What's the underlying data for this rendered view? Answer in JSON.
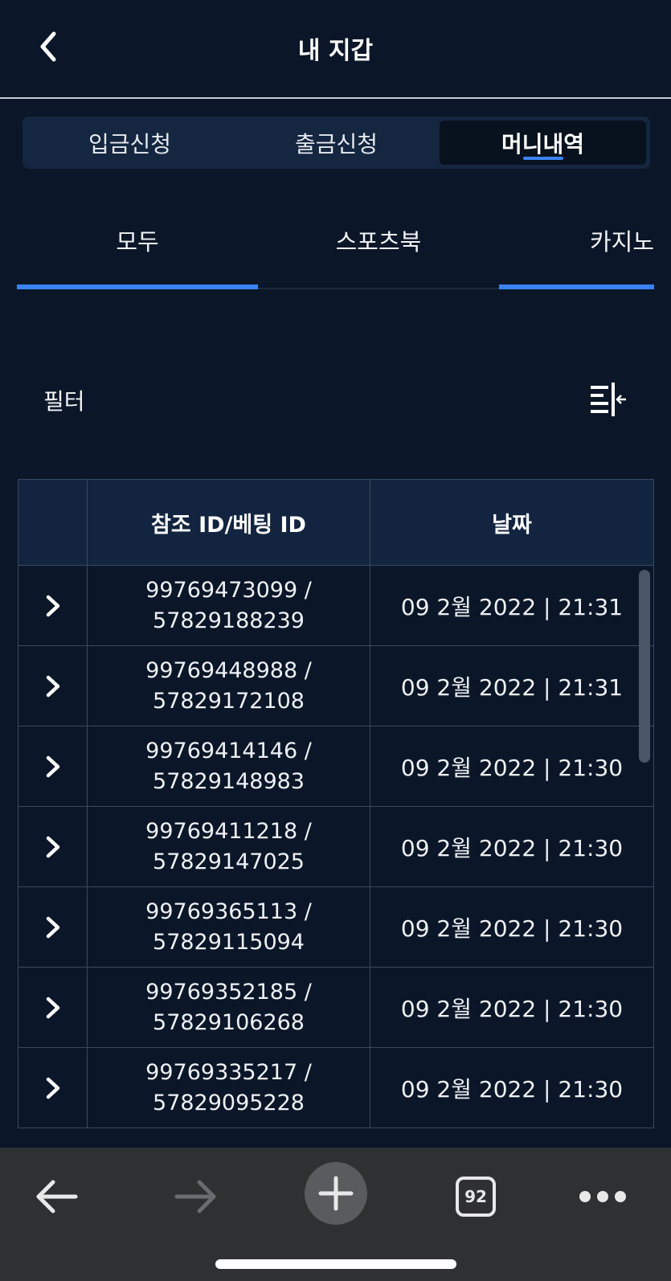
{
  "header": {
    "title": "내 지갑"
  },
  "segments": [
    {
      "label": "입금신청",
      "active": false
    },
    {
      "label": "출금신청",
      "active": false
    },
    {
      "label": "머니내역",
      "active": true
    }
  ],
  "subtabs": [
    {
      "label": "모두"
    },
    {
      "label": "스포츠북"
    },
    {
      "label": "카지노"
    }
  ],
  "filter": {
    "label": "필터"
  },
  "table": {
    "headers": [
      "",
      "참조 ID/베팅 ID",
      "날짜"
    ],
    "rows": [
      {
        "ref": "99769473099 /",
        "bet": "57829188239",
        "date": "09 2월 2022 | 21:31"
      },
      {
        "ref": "99769448988 /",
        "bet": "57829172108",
        "date": "09 2월 2022 | 21:31"
      },
      {
        "ref": "99769414146 /",
        "bet": "57829148983",
        "date": "09 2월 2022 | 21:30"
      },
      {
        "ref": "99769411218 /",
        "bet": "57829147025",
        "date": "09 2월 2022 | 21:30"
      },
      {
        "ref": "99769365113 /",
        "bet": "57829115094",
        "date": "09 2월 2022 | 21:30"
      },
      {
        "ref": "99769352185 /",
        "bet": "57829106268",
        "date": "09 2월 2022 | 21:30"
      },
      {
        "ref": "99769335217 /",
        "bet": "57829095228",
        "date": "09 2월 2022 | 21:30"
      }
    ]
  },
  "browser": {
    "tab_count": "92"
  },
  "colors": {
    "background": "#0b1628",
    "accent": "#3b82f6",
    "toolbar": "#2f3032"
  }
}
